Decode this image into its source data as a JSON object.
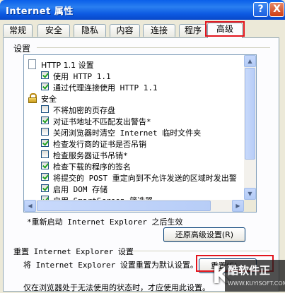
{
  "window": {
    "title": "Internet 属性",
    "help_glyph": "?",
    "close_glyph": "X"
  },
  "tabs": [
    {
      "label": "常规"
    },
    {
      "label": "安全"
    },
    {
      "label": "隐私"
    },
    {
      "label": "内容"
    },
    {
      "label": "连接"
    },
    {
      "label": "程序"
    },
    {
      "label": "高级",
      "active": true
    }
  ],
  "settings": {
    "group_title": "设置",
    "items": [
      {
        "type": "category",
        "icon": "page-icon",
        "label": "HTTP 1.1 设置"
      },
      {
        "type": "checkbox",
        "checked": true,
        "label": "使用 HTTP 1.1"
      },
      {
        "type": "checkbox",
        "checked": true,
        "label": "通过代理连接使用 HTTP 1.1"
      },
      {
        "type": "category",
        "icon": "lock-icon",
        "label": "安全"
      },
      {
        "type": "checkbox",
        "checked": false,
        "label": "不将加密的页存盘"
      },
      {
        "type": "checkbox",
        "checked": true,
        "label": "对证书地址不匹配发出警告*"
      },
      {
        "type": "checkbox",
        "checked": false,
        "label": "关闭浏览器时清空 Internet 临时文件夹"
      },
      {
        "type": "checkbox",
        "checked": true,
        "label": "检查发行商的证书是否吊销"
      },
      {
        "type": "checkbox",
        "checked": false,
        "label": "检查服务器证书吊销*"
      },
      {
        "type": "checkbox",
        "checked": true,
        "label": "检查下载的程序的签名"
      },
      {
        "type": "checkbox",
        "checked": true,
        "label": "将提交的 POST 重定向到不允许发送的区域时发出警"
      },
      {
        "type": "checkbox",
        "checked": true,
        "label": "启用 DOM 存储"
      },
      {
        "type": "checkbox",
        "checked": true,
        "label": "启用 SmartScreen 筛选器"
      }
    ],
    "restart_note": "*重新启动 Internet Explorer 之后生效",
    "restore_button": "还原高级设置(R)"
  },
  "reset": {
    "group_title": "重置 Internet Explorer 设置",
    "description": "将 Internet Explorer 设置重置为默认设置。",
    "button": "重置(S)...",
    "footer": "仅在浏览器处于无法使用的状态时，才应使用此设置。"
  },
  "watermark": {
    "letter": "K",
    "title": "酷软件正",
    "url": "WWW.KUYISOFT.COM"
  },
  "colors": {
    "title_bar": "#0a5fe9",
    "highlight_box": "#e2151d",
    "checkmark": "#21a121",
    "dialog_bg": "#ece9d8"
  }
}
